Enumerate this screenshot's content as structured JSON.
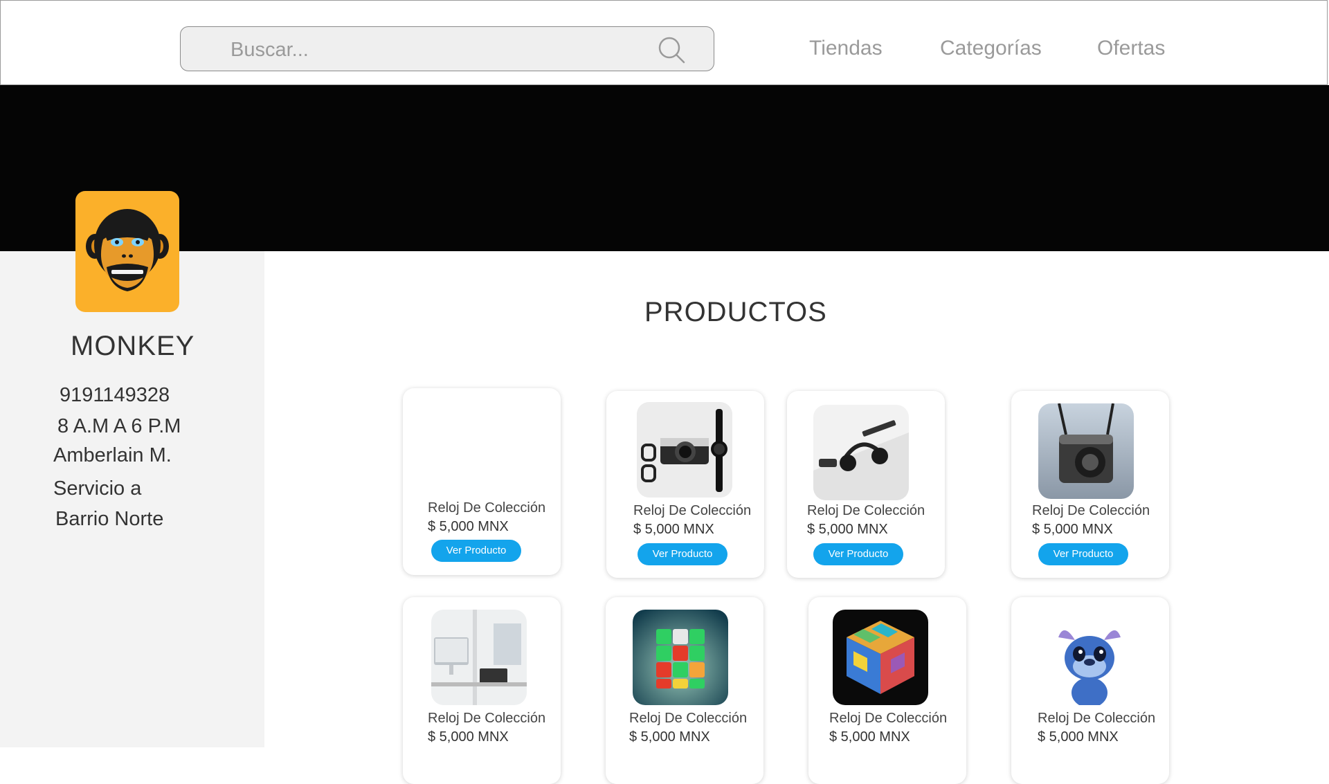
{
  "header": {
    "search_placeholder": "Buscar...",
    "nav": [
      "Tiendas",
      "Categorías",
      "Ofertas"
    ]
  },
  "store": {
    "name": "MONKEY",
    "phone": "9191149328",
    "hours": "8 A.M A 6 P.M",
    "owner": "Amberlain M.",
    "service_line1": "Servicio a",
    "service_line2": "Barrio Norte"
  },
  "products_title": "PRODUCTOS",
  "products": [
    {
      "name": "Reloj De Colección",
      "price": "$ 5,000 MNX",
      "button": "Ver Producto",
      "image": "blank"
    },
    {
      "name": "Reloj De Colección",
      "price": "$ 5,000 MNX",
      "button": "Ver Producto",
      "image": "camera-glasses-watch"
    },
    {
      "name": "Reloj De Colección",
      "price": "$ 5,000 MNX",
      "button": "Ver Producto",
      "image": "headphones-desk"
    },
    {
      "name": "Reloj De Colección",
      "price": "$ 5,000 MNX",
      "button": "Ver Producto",
      "image": "instant-camera"
    },
    {
      "name": "Reloj De Colección",
      "price": "$ 5,000 MNX",
      "image": "office-desk"
    },
    {
      "name": "Reloj De Colección",
      "price": "$ 5,000 MNX",
      "image": "rubiks-cube"
    },
    {
      "name": "Reloj De Colección",
      "price": "$ 5,000 MNX",
      "image": "art-cube"
    },
    {
      "name": "Reloj De Colección",
      "price": "$ 5,000 MNX",
      "image": "stitch-figure"
    }
  ],
  "colors": {
    "accent": "#13a4ec",
    "banner": "#050505",
    "logo_bg": "#fbb02a",
    "sidebar_bg": "#f3f3f3"
  }
}
